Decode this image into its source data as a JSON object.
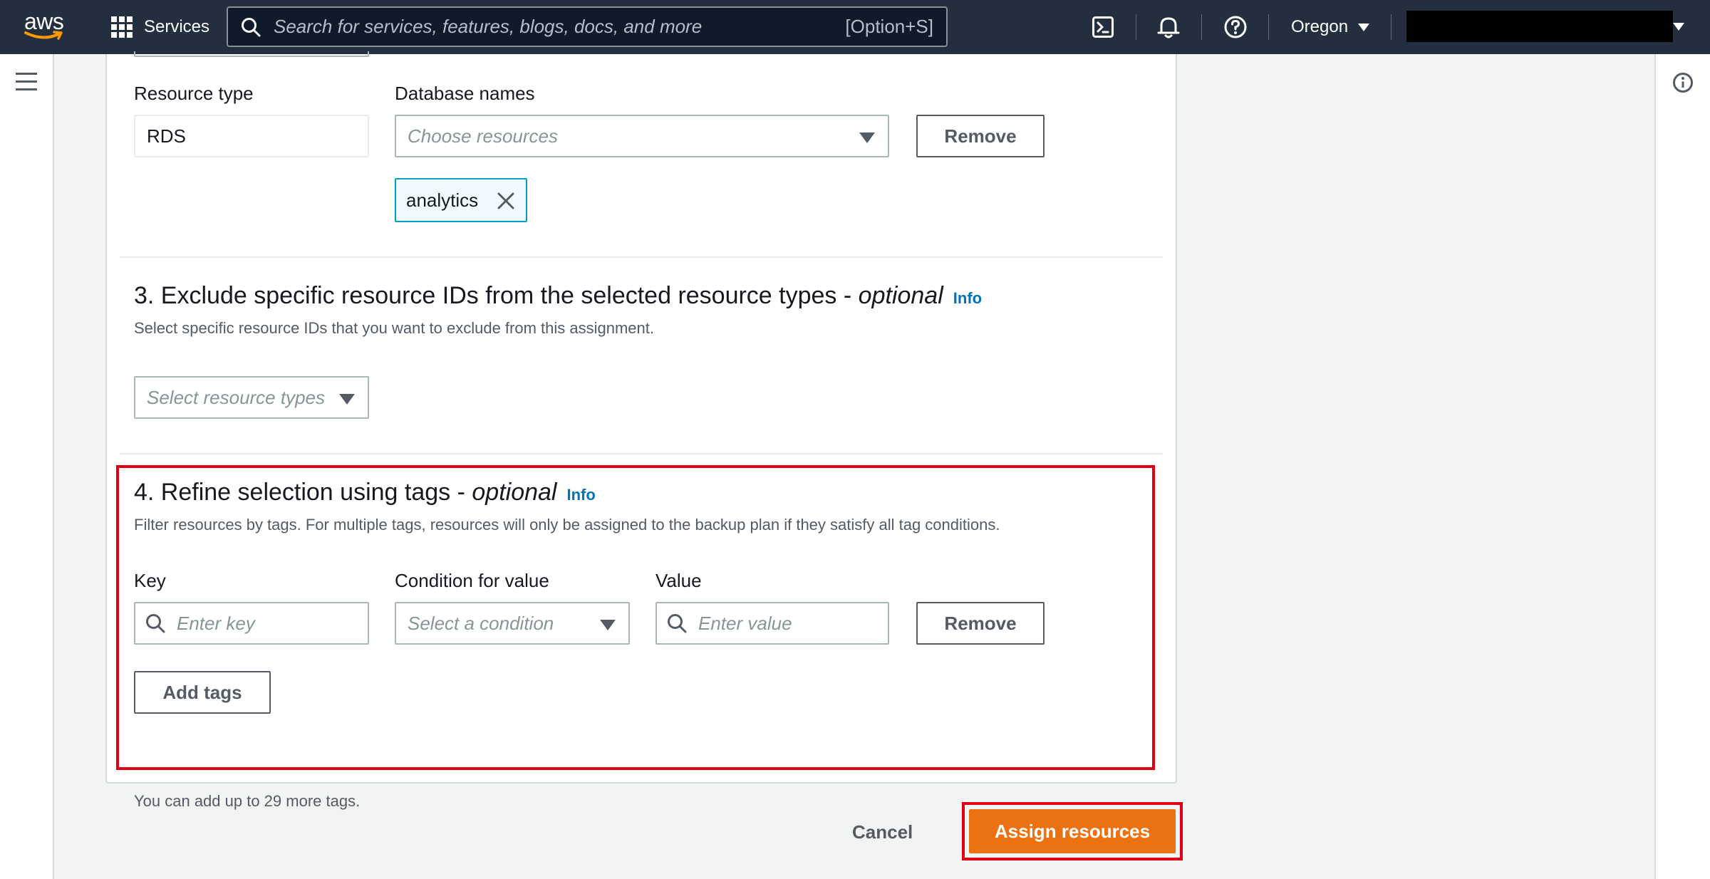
{
  "nav": {
    "logo_text": "aws",
    "services_label": "Services",
    "search_placeholder": "Search for services, features, blogs, docs, and more",
    "search_shortcut": "[Option+S]",
    "region_label": "Oregon",
    "icons": [
      "cloudshell-icon",
      "bell-icon",
      "help-icon"
    ]
  },
  "resource_row": {
    "resource_type_label": "Resource type",
    "resource_type_value": "RDS",
    "database_names_label": "Database names",
    "database_names_placeholder": "Choose resources",
    "remove_label": "Remove",
    "selected_tokens": [
      "analytics"
    ]
  },
  "section3": {
    "title_prefix": "3. Exclude specific resource IDs from the selected resource types - ",
    "title_optional": "optional",
    "info_label": "Info",
    "description": "Select specific resource IDs that you want to exclude from this assignment.",
    "select_placeholder": "Select resource types"
  },
  "section4": {
    "title_prefix": "4. Refine selection using tags - ",
    "title_optional": "optional",
    "info_label": "Info",
    "description": "Filter resources by tags. For multiple tags, resources will only be assigned to the backup plan if they satisfy all tag conditions.",
    "key_label": "Key",
    "key_placeholder": "Enter key",
    "condition_label": "Condition for value",
    "condition_placeholder": "Select a condition",
    "value_label": "Value",
    "value_placeholder": "Enter value",
    "remove_label": "Remove",
    "add_tags_label": "Add tags",
    "limit_note": "You can add up to 29 more tags."
  },
  "footer": {
    "cancel_label": "Cancel",
    "assign_label": "Assign resources"
  },
  "colors": {
    "nav_bg": "#232f3e",
    "primary": "#ec7211",
    "link": "#0073bb",
    "highlight": "#e00016",
    "token_border": "#00a1c9"
  }
}
